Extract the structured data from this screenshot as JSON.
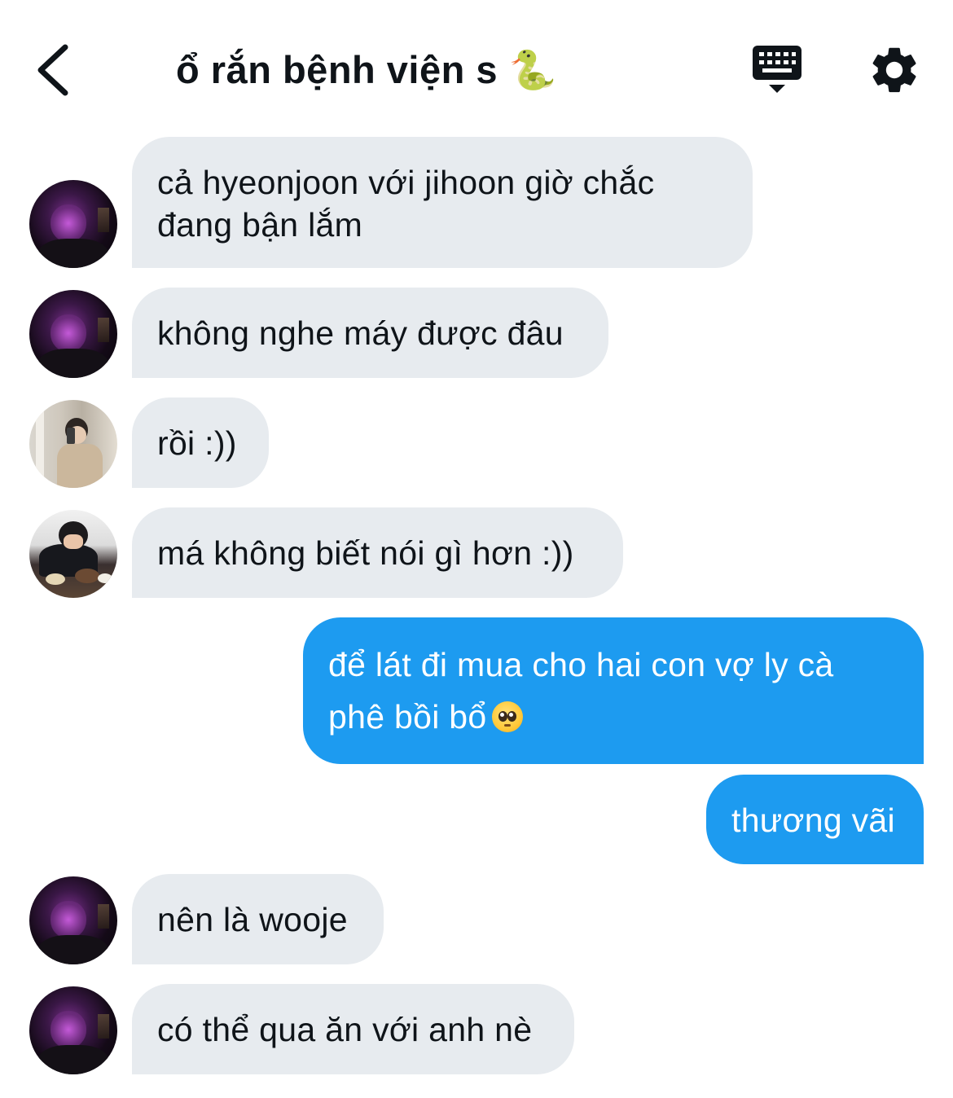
{
  "header": {
    "title": "ổ rắn bệnh viện s 🐍",
    "back_icon": "chevron-left-icon",
    "keyboard_icon": "keyboard-icon",
    "settings_icon": "gear-icon"
  },
  "colors": {
    "incoming_bubble": "#e7ebef",
    "outgoing_bubble": "#1d9bf0",
    "text": "#0f1419"
  },
  "messages": [
    {
      "side": "incoming",
      "avatar": "dark",
      "lines": [
        "cả hyeonjoon với jihoon giờ chắc",
        "đang bận lắm"
      ]
    },
    {
      "side": "incoming",
      "avatar": "dark",
      "lines": [
        "không nghe máy được đâu"
      ]
    },
    {
      "side": "incoming",
      "avatar": "mirror-selfie",
      "lines": [
        "rồi :))"
      ]
    },
    {
      "side": "incoming",
      "avatar": "eating",
      "lines": [
        "má không biết nói gì hơn :))"
      ]
    },
    {
      "side": "outgoing",
      "lines": [
        "để lát đi mua cho hai con vợ ly cà",
        "phê bồi bổ"
      ],
      "emoji": "pleading-face-emoji"
    },
    {
      "side": "outgoing",
      "lines": [
        "thương vãi"
      ]
    },
    {
      "side": "incoming",
      "avatar": "dark",
      "lines": [
        "nên là wooje"
      ]
    },
    {
      "side": "incoming",
      "avatar": "dark",
      "lines": [
        "có thể qua ăn với anh nè"
      ]
    }
  ]
}
